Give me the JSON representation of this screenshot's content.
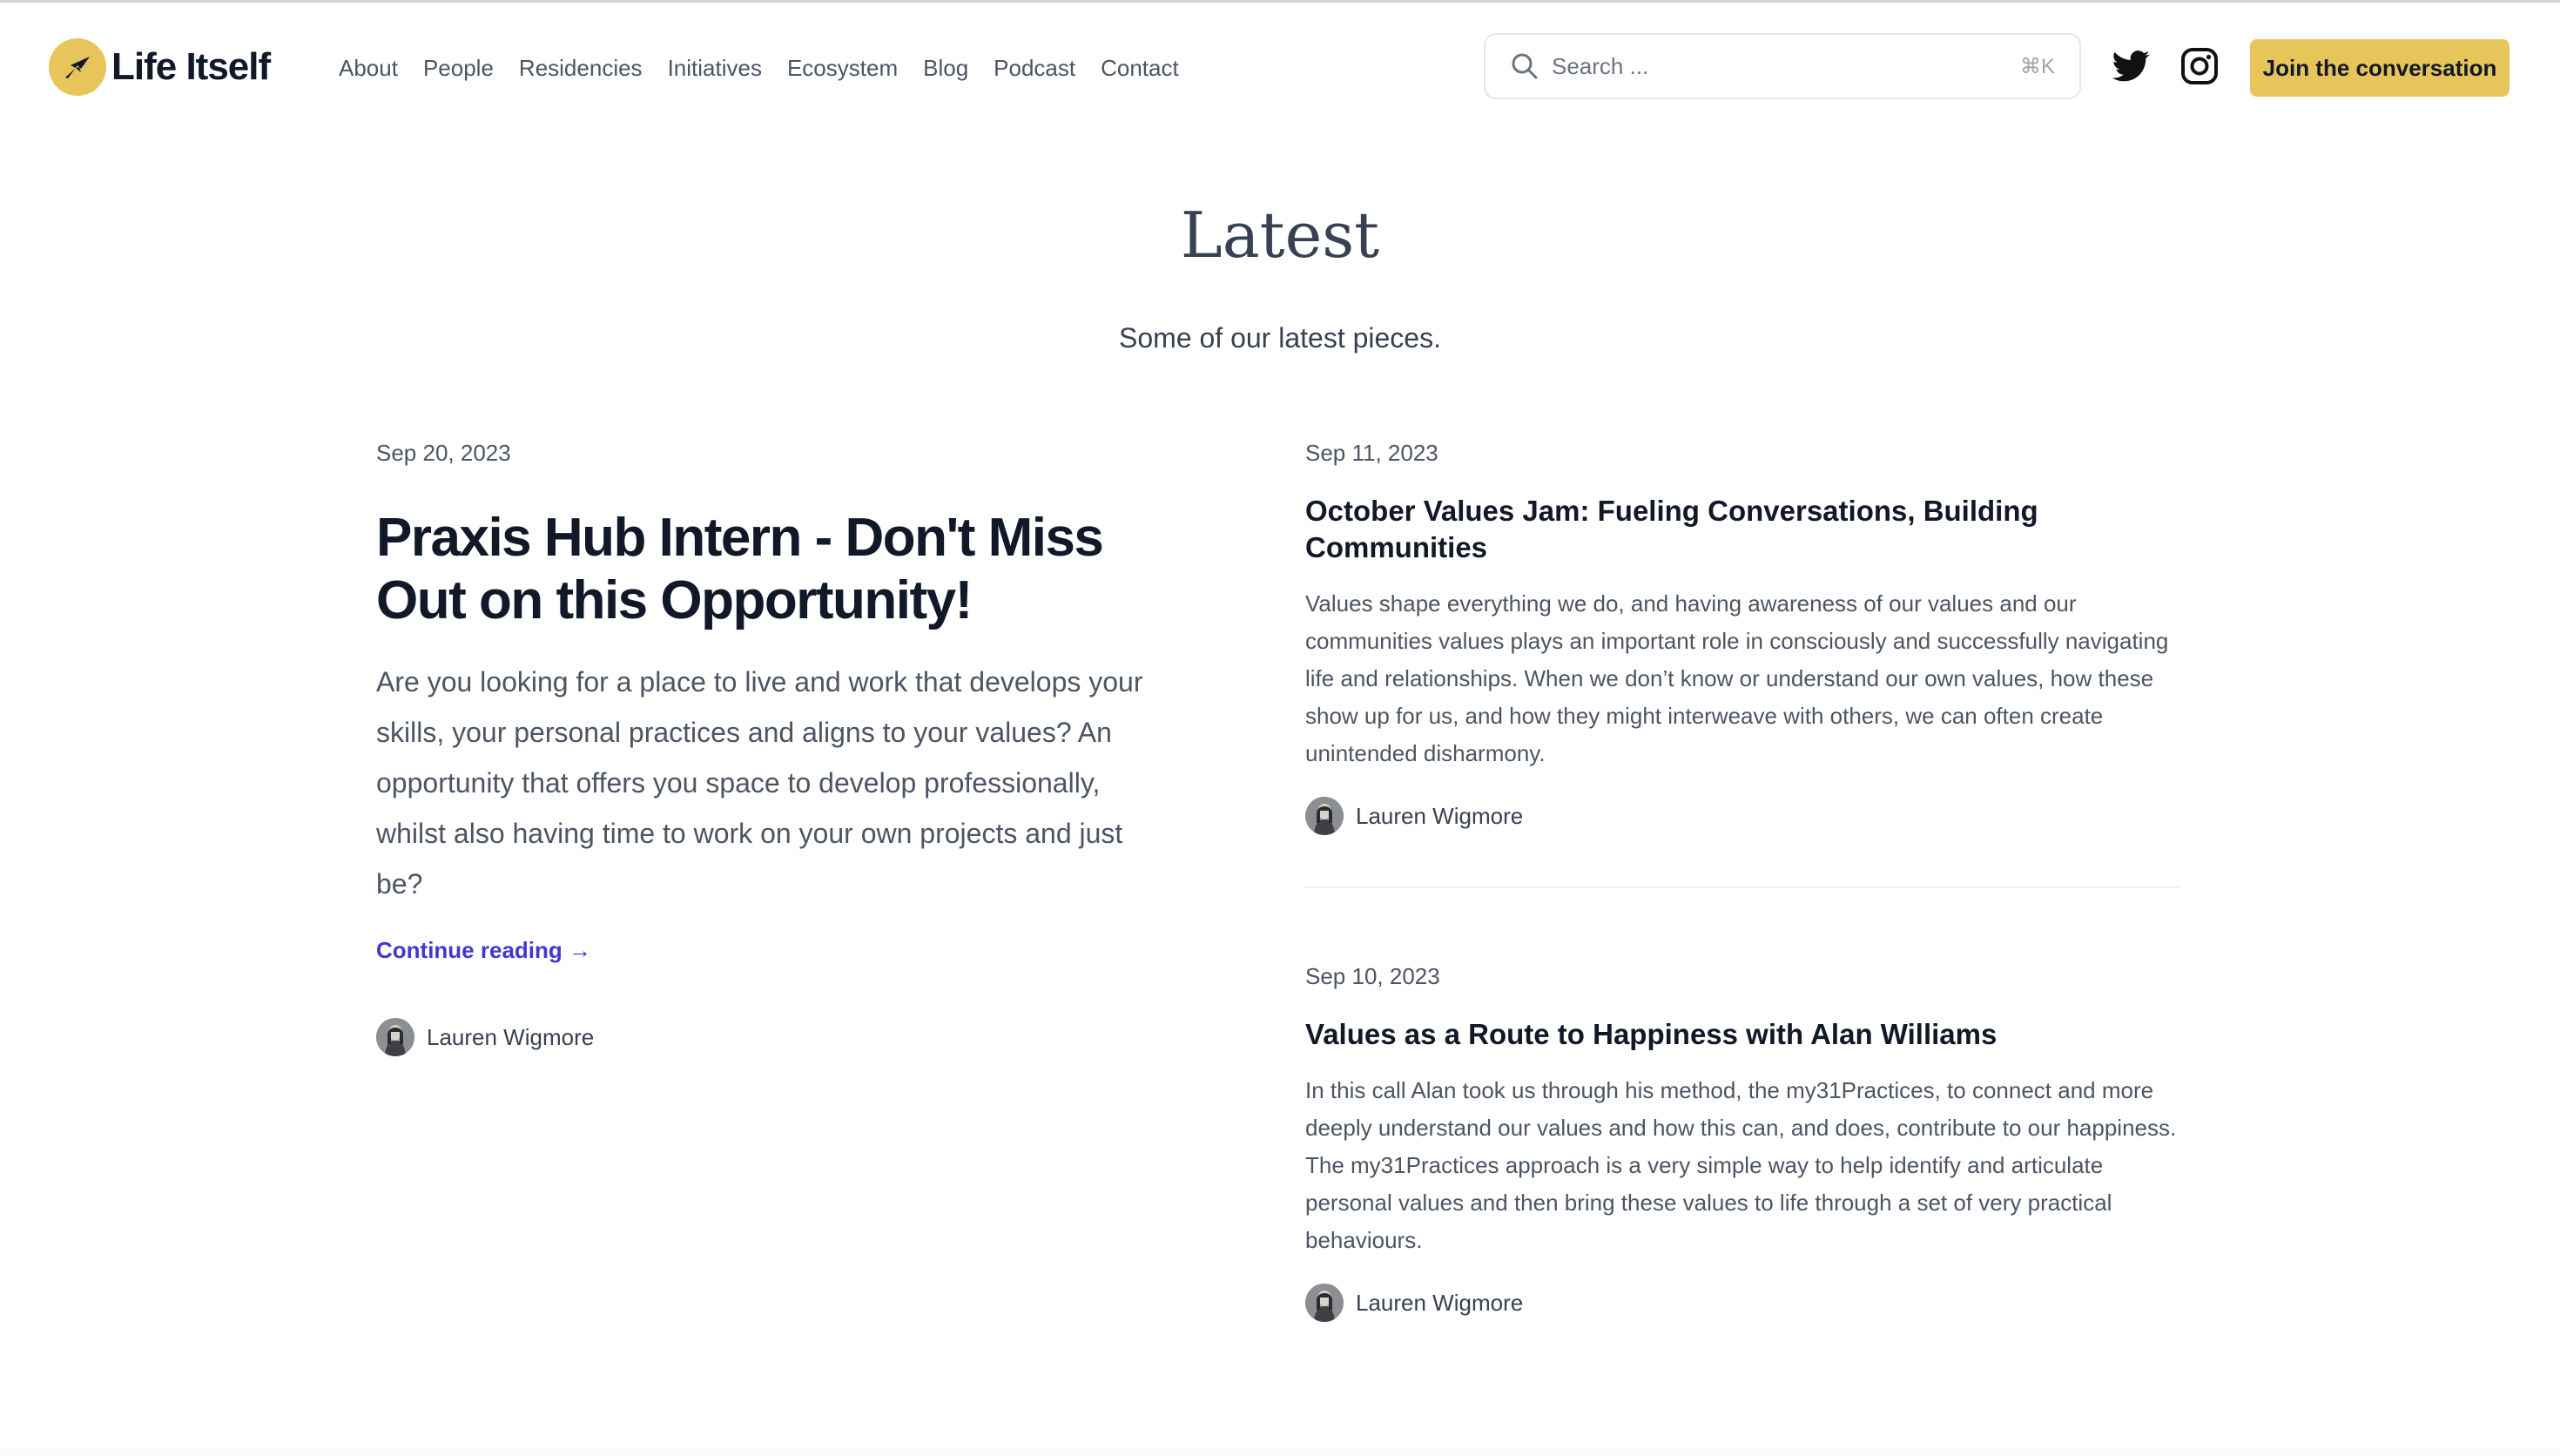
{
  "header": {
    "logo_text": "Life Itself",
    "nav": [
      {
        "label": "About"
      },
      {
        "label": "People"
      },
      {
        "label": "Residencies"
      },
      {
        "label": "Initiatives"
      },
      {
        "label": "Ecosystem"
      },
      {
        "label": "Blog"
      },
      {
        "label": "Podcast"
      },
      {
        "label": "Contact"
      }
    ],
    "search": {
      "placeholder": "Search ...",
      "shortcut": "⌘K",
      "icon": "search-icon"
    },
    "social": [
      {
        "icon": "twitter-icon"
      },
      {
        "icon": "instagram-icon"
      }
    ],
    "cta_label": "Join the conversation",
    "accent_color": "#e8c55b"
  },
  "hero": {
    "title": "Latest",
    "subtitle": "Some of our latest pieces."
  },
  "featured": {
    "date": "Sep 20, 2023",
    "title": "Praxis Hub Intern - Don't Miss Out on this Opportunity!",
    "excerpt": "Are you looking for a place to live and work that develops your skills, your personal practices and aligns to your values? An opportunity that offers you space to develop professionally, whilst also having time to work on your own projects and just be?",
    "continue_label": "Continue reading →",
    "author": "Lauren Wigmore",
    "link_color": "#4338ca"
  },
  "posts": [
    {
      "date": "Sep 11, 2023",
      "title": "October Values Jam: Fueling Conversations, Building Communities",
      "excerpt": "Values shape everything we do, and having awareness of our values and our communities values plays an important role in consciously and successfully navigating life and relationships. When we don’t know or understand our own values, how these show up for us, and how they might interweave with others, we can often create unintended disharmony.",
      "author": "Lauren Wigmore"
    },
    {
      "date": "Sep 10, 2023",
      "title": "Values as a Route to Happiness with Alan Williams",
      "excerpt": "In this call Alan took us through his method, the my31Practices, to connect and more deeply understand our values and how this can, and does, contribute to our happiness. The my31Practices approach is a very simple way to help identify and articulate personal values and then bring these values to life through a set of very practical behaviours.",
      "author": "Lauren Wigmore"
    }
  ]
}
